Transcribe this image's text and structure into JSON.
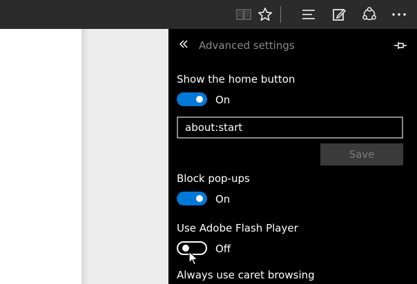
{
  "toolbar": {
    "icons": [
      "reading-view-icon",
      "favorite-star-icon",
      "hub-icon",
      "web-note-icon",
      "share-icon",
      "more-icon"
    ]
  },
  "panel": {
    "title": "Advanced settings",
    "home_button": {
      "label": "Show the home button",
      "state": "On",
      "url": "about:start",
      "save_label": "Save"
    },
    "popups": {
      "label": "Block pop-ups",
      "state": "On"
    },
    "flash": {
      "label": "Use Adobe Flash Player",
      "state": "Off"
    },
    "caret": {
      "label": "Always use caret browsing"
    }
  },
  "colors": {
    "accent": "#0078d7",
    "toolbar_bg": "#2b2b2b",
    "panel_bg": "#000000"
  }
}
